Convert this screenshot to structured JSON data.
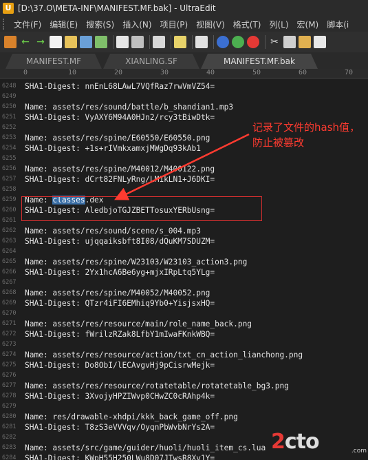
{
  "window": {
    "title": "[D:\\37.O\\META-INF\\MANIFEST.MF.bak] - UltraEdit"
  },
  "menu": [
    "文件(F)",
    "编辑(E)",
    "搜索(S)",
    "插入(N)",
    "项目(P)",
    "视图(V)",
    "格式(T)",
    "列(L)",
    "宏(M)",
    "脚本(i"
  ],
  "tabs": [
    {
      "label": "MANIFEST.MF",
      "active": false
    },
    {
      "label": "XIANLING.SF",
      "active": false
    },
    {
      "label": "MANIFEST.MF.bak",
      "active": true
    }
  ],
  "ruler": {
    "marks": [
      "0",
      "10",
      "20",
      "30",
      "40",
      "50",
      "60",
      "70"
    ]
  },
  "lines": [
    {
      "n": "6248",
      "text": "SHA1-Digest: nnEnL68LAwL7VQfRaz7rwVmVZ54="
    },
    {
      "n": "6249",
      "text": ""
    },
    {
      "n": "6250",
      "text": "Name: assets/res/sound/battle/b_shandian1.mp3"
    },
    {
      "n": "6251",
      "text": "SHA1-Digest: VyAXY6M94A0HJn2/rcy3tBiwDtk="
    },
    {
      "n": "6252",
      "text": ""
    },
    {
      "n": "6253",
      "text": "Name: assets/res/spine/E60550/E60550.png"
    },
    {
      "n": "6254",
      "text": "SHA1-Digest: +1s+rIVmkxamxjMWgDq93kAb1"
    },
    {
      "n": "6255",
      "text": ""
    },
    {
      "n": "6256",
      "text": "Name: assets/res/spine/M40012/M400122.png"
    },
    {
      "n": "6257",
      "text": "SHA1-Digest: dCrt82FNLyRng/LM1kLN1+J6DKI="
    },
    {
      "n": "6258",
      "text": ""
    },
    {
      "n": "6259",
      "pre": "Name: ",
      "sel": "classes",
      "post": ".dex"
    },
    {
      "n": "6260",
      "text": "SHA1-Digest: AledbjoTGJZBETTosuxYERbUsng="
    },
    {
      "n": "6261",
      "text": ""
    },
    {
      "n": "6262",
      "text": "Name: assets/res/sound/scene/s_004.mp3"
    },
    {
      "n": "6263",
      "text": "SHA1-Digest: ujqqaiksbft8I08/dQuKM7SDUZM="
    },
    {
      "n": "6264",
      "text": ""
    },
    {
      "n": "6265",
      "text": "Name: assets/res/spine/W23103/W23103_action3.png"
    },
    {
      "n": "6266",
      "text": "SHA1-Digest: 2Yx1hcA6Be6yg+mjxIRpLtq5YLg="
    },
    {
      "n": "6267",
      "text": ""
    },
    {
      "n": "6268",
      "text": "Name: assets/res/spine/M40052/M40052.png"
    },
    {
      "n": "6269",
      "text": "SHA1-Digest: QTzr4iFI6EMhiq9Yb0+YisjsxHQ="
    },
    {
      "n": "6270",
      "text": ""
    },
    {
      "n": "6271",
      "text": "Name: assets/res/resource/main/role_name_back.png"
    },
    {
      "n": "6272",
      "text": "SHA1-Digest: fWrilzRZak8LfbY1mIwaFKnkWBQ="
    },
    {
      "n": "6273",
      "text": ""
    },
    {
      "n": "6274",
      "text": "Name: assets/res/resource/action/txt_cn_action_lianchong.png"
    },
    {
      "n": "6275",
      "text": "SHA1-Digest: Do8ObI/lECAvgvHj9pCisrwMejk="
    },
    {
      "n": "6276",
      "text": ""
    },
    {
      "n": "6277",
      "text": "Name: assets/res/resource/rotatetable/rotatetable_bg3.png"
    },
    {
      "n": "6278",
      "text": "SHA1-Digest: 3XvojyHPZIWvp0CHwZC0cRAhp4k="
    },
    {
      "n": "6279",
      "text": ""
    },
    {
      "n": "6280",
      "text": "Name: res/drawable-xhdpi/kkk_back_game_off.png"
    },
    {
      "n": "6281",
      "text": "SHA1-Digest: T8zS3eVVVqv/OyqnPbWvbNrYs2A="
    },
    {
      "n": "6282",
      "text": ""
    },
    {
      "n": "6283",
      "text": "Name: assets/src/game/guider/huoli/huoli_item_cs.lua"
    },
    {
      "n": "6284",
      "text": "SHA1-Digest: KWpH55H250LWu8D07JTwsR8Xv1Y="
    }
  ],
  "annotation": {
    "line1": "记录了文件的hash值，",
    "line2": "防止被篡改",
    "color": "#ff3b30"
  },
  "watermark": {
    "big_a": "2",
    "big_b": "cto",
    "small": ".com"
  }
}
